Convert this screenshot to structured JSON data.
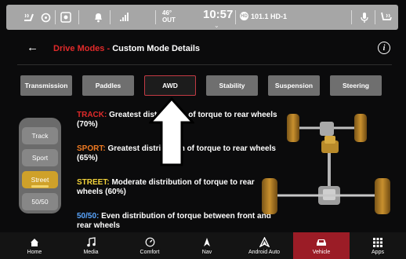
{
  "statusbar": {
    "temperature": "46°",
    "temperature_unit": "OUT",
    "time": "10:57",
    "radio_station": "101.1 HD-1",
    "radio_badge": "HD"
  },
  "header": {
    "breadcrumb": "Drive Modes -",
    "title": "Custom Mode Details"
  },
  "tabs": [
    {
      "label": "Transmission"
    },
    {
      "label": "Paddles"
    },
    {
      "label": "AWD",
      "active": true
    },
    {
      "label": "Stability"
    },
    {
      "label": "Suspension"
    },
    {
      "label": "Steering"
    }
  ],
  "modes": {
    "track": "Track",
    "sport": "Sport",
    "street": "Street",
    "fifty": "50/50",
    "selected": "Street"
  },
  "descriptions": [
    {
      "key": "TRACK:",
      "text": "Greatest distribution of torque to rear wheels (70%)"
    },
    {
      "key": "SPORT:",
      "text": "Greatest distribution of torque to rear wheels (65%)"
    },
    {
      "key": "STREET:",
      "text": "Moderate distribution of torque to rear wheels (60%)"
    },
    {
      "key": "50/50:",
      "text": "Even distribution of torque between front and rear wheels"
    }
  ],
  "nav": [
    {
      "label": "Home",
      "icon": "home-icon"
    },
    {
      "label": "Media",
      "icon": "music-note-icon"
    },
    {
      "label": "Comfort",
      "icon": "gauge-icon"
    },
    {
      "label": "Nav",
      "icon": "navigation-arrow-icon"
    },
    {
      "label": "Android Auto",
      "icon": "android-auto-icon"
    },
    {
      "label": "Vehicle",
      "icon": "car-icon",
      "active": true
    },
    {
      "label": "Apps",
      "icon": "grid-icon"
    }
  ],
  "colors": {
    "accent_red": "#e02a2a",
    "street_gold": "#cfa12a",
    "sport_orange": "#ef7a22",
    "street_yellow": "#f2d23a",
    "fifty_blue": "#5aa6ff",
    "vehicle_active": "#9b1c26"
  }
}
